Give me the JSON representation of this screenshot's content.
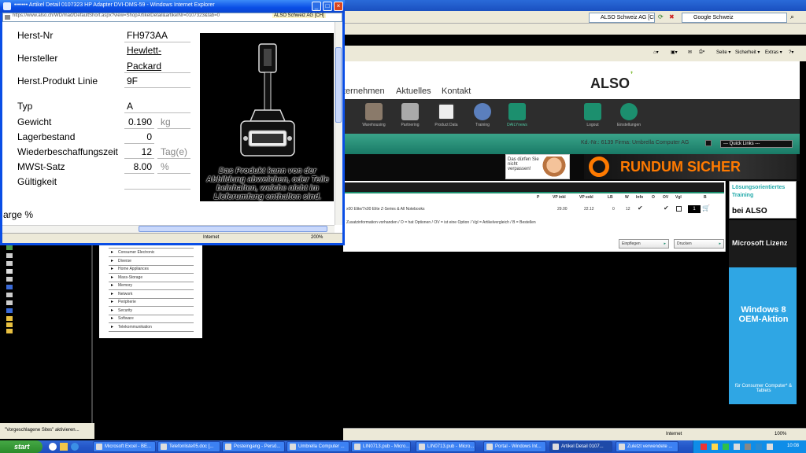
{
  "popup": {
    "title": "••••••• Artikel Detail 0107323 HP Adapter DVI-DMS-59 - Windows Internet Explorer",
    "url": "https://www.also.ch/WD/mad/DefaultShort.aspx?view=ShopArtikelDetail&artikelNr=0107323&tab=0",
    "cert": "ALSO Schweiz AG [CH]",
    "fields": {
      "herst_nr_label": "Herst-Nr",
      "herst_nr": "FH973AA",
      "hersteller_label": "Hersteller",
      "hersteller_1": "Hewlett-",
      "hersteller_2": "Packard",
      "produkt_linie_label": "Herst.Produkt Linie",
      "produkt_linie": "9F",
      "typ_label": "Typ",
      "typ": "A",
      "gewicht_label": "Gewicht",
      "gewicht": "0.190",
      "gewicht_unit": "kg",
      "lager_label": "Lagerbestand",
      "lager": "0",
      "wbz_label": "Wiederbeschaffungszeit",
      "wbz": "12",
      "wbz_unit": "Tag(e)",
      "mwst_label": "MWSt-Satz",
      "mwst": "8.00",
      "mwst_unit": "%",
      "gueltig_label": "Gültigkeit"
    },
    "marge_label": "arge %",
    "image_caption": "Das Produkt kann von der Abbildung abweichen, oder Teile beinhalten, welche nicht im Lieferumfang enthalten sind.",
    "status_zone": "Internet",
    "status_zoom": "200%"
  },
  "browser": {
    "tab1": "ALSO Schweiz AG [CH]",
    "search": "Google Schweiz",
    "cmd_seite": "Seite ▾",
    "cmd_sicherheit": "Sicherheit ▾",
    "cmd_extras": "Extras ▾",
    "status_zone": "Internet",
    "status_zoom": "100%"
  },
  "site": {
    "menu": [
      "ternehmen",
      "Aktuelles",
      "Kontakt"
    ],
    "logo": "ALSO",
    "icons": [
      {
        "label": "Warehousing",
        "color": "#8a7a6a"
      },
      {
        "label": "Partnering",
        "color": "#aaaaaa"
      },
      {
        "label": "Product Data",
        "color": "#cccccc"
      },
      {
        "label": "Training",
        "color": "#5b7fbd"
      },
      {
        "label": "DAILYnews",
        "color": "#1c8f6e"
      },
      {
        "label": "Logout",
        "color": "#1c8f6e"
      },
      {
        "label": "Einstellungen",
        "color": "#1c8f6e"
      }
    ],
    "kd_info": "Kd.-Nr.: 6139 Firma: Umbrella Computer AG",
    "quick_links": "--- Quick Links ---",
    "promo1": "Das dürfen Sie nicht verpassen!",
    "promo2": "RUNDUM SICHER",
    "table": {
      "headers": [
        "P",
        "VP inkl",
        "VP exkl",
        "LB",
        "W",
        "Info",
        "O",
        "OV",
        "Vgl",
        "B"
      ],
      "row": {
        "name": "x00 Elite/7x00 Elite Z-Series & All Notebooks",
        "vp_inkl": "29.00",
        "vp_exkl": "22.12",
        "lb": "0",
        "w": "12",
        "qty": "1"
      }
    },
    "legend": "Zusatzinformation vorhanden / O = hat Optionen / OV = ist eine Option / Vgl = Artikelvergleich / B = Bestellen",
    "btn_einpflegen": "Einpflegen",
    "btn_drucken": "Drucken",
    "categories": [
      "Consumable",
      "Consumer Electronic",
      "Diverse",
      "Home Appliances",
      "Mass-Storage",
      "Memory",
      "Network",
      "Peripherie",
      "Security",
      "Software",
      "Telekommunikation"
    ],
    "ad1_line1": "Lösungsorientiertes",
    "ad1_line2": "Training",
    "ad1_line3": "bei ALSO",
    "ad2": "Microsoft Lizenz",
    "ad3_a": "Windows 8 OEM-Aktion",
    "ad3_b": "für Consumer Computer* & Tablets"
  },
  "suggest_bar": "\"Vorgeschlagene Sites\" aktivieren...",
  "taskbar": {
    "start": "start",
    "tasks": [
      "Microsoft Excel - BE...",
      "Telefonliste05.doc [...",
      "Posteingang - Persö...",
      "Umbrella Computer ...",
      "LIN0713.pub - Micro...",
      "LIN0713.pub - Micro...",
      "Portal - Windows Int...",
      "Artikel Detail 0107...",
      "Zuletzt verwendete ..."
    ],
    "clock": "10:08"
  }
}
